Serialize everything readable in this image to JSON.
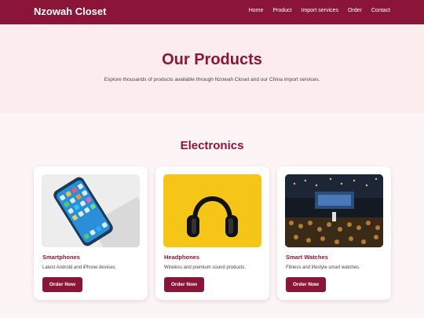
{
  "header": {
    "brand": "Nzowah Closet",
    "nav": [
      "Home",
      "Product",
      "Import services",
      "Order",
      "Contact"
    ]
  },
  "hero": {
    "title": "Our Products",
    "subtitle": "Explore thousands of products available through Nzowah Closet and our China import services."
  },
  "section": {
    "title": "Electronics"
  },
  "products": [
    {
      "title": "Smartphones",
      "desc": "Latest Android and iPhone devices.",
      "button": "Order Now"
    },
    {
      "title": "Headphones",
      "desc": "Wireless and premium sound products.",
      "button": "Order Now"
    },
    {
      "title": "Smart Watches",
      "desc": "Fitness and lifestyle smart watches.",
      "button": "Order Now"
    }
  ],
  "colors": {
    "brand": "#8b1538",
    "heroBg": "#fdeced",
    "pageBg": "#fdf5f5"
  }
}
